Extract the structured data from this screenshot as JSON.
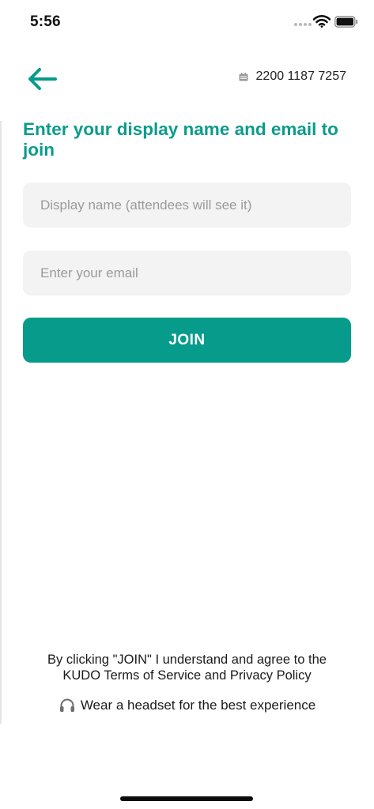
{
  "status_bar": {
    "time": "5:56"
  },
  "header": {
    "back_icon": "arrow-left-icon",
    "meeting_icon": "calendar-icon",
    "meeting_id": "2200 1187 7257"
  },
  "page": {
    "title": "Enter your display name and email to join"
  },
  "form": {
    "display_name": {
      "value": "",
      "placeholder": "Display name (attendees will see it)"
    },
    "email": {
      "value": "",
      "placeholder": "Enter your email"
    },
    "join_label": "JOIN"
  },
  "footer": {
    "terms_line1": "By clicking \"JOIN\" I understand and agree to the",
    "terms_line2": "KUDO Terms of Service and Privacy Policy",
    "headset_icon": "headset-icon",
    "headset_note": "Wear a headset for the best experience"
  },
  "colors": {
    "accent": "#079b8c",
    "field_background": "#f3f3f3"
  }
}
